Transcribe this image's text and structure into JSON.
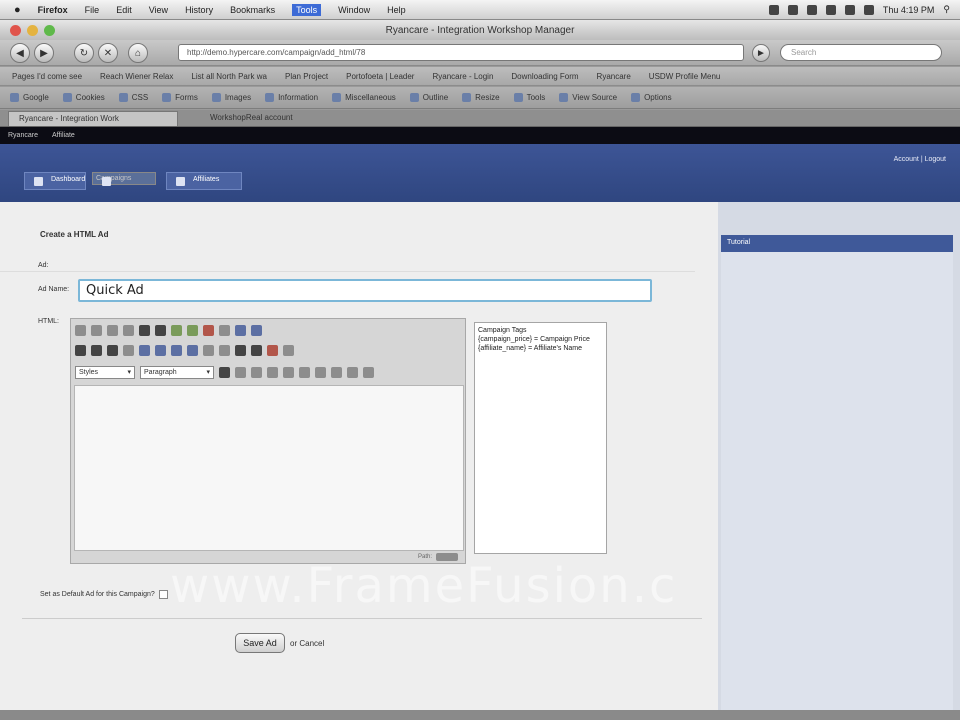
{
  "os_menu": {
    "apple": "",
    "items": [
      "Firefox",
      "File",
      "Edit",
      "View",
      "History",
      "Bookmarks",
      "Tools",
      "Window",
      "Help"
    ],
    "clock": "Thu 4:19 PM"
  },
  "window": {
    "title": "Ryancare - Integration Workshop Manager"
  },
  "browser": {
    "url": "http://demo.hypercare.com/campaign/add_html/78",
    "search_placeholder": "Search",
    "bookmarks": [
      "Pages I'd come see",
      "Reach Wiener Relax",
      "List all North Park wa",
      "Plan Project",
      "Portofoeta | Leader",
      "Ryancare - Login",
      "Downloading Form",
      "Ryancare",
      "USDW Profile Menu"
    ],
    "extensions": [
      "Google",
      "Cookies",
      "CSS",
      "Forms",
      "Images",
      "Information",
      "Miscellaneous",
      "Outline",
      "Resize",
      "Tools",
      "View Source",
      "Options"
    ],
    "tabs": [
      "Ryancare - Integration Work",
      "WorkshopReal account"
    ]
  },
  "app": {
    "top_strip": [
      "Ryancare",
      "Affiliate"
    ],
    "user_links": "Account | Logout",
    "nav_tabs": [
      {
        "label": "Dashboard"
      },
      {
        "label": "Campaigns"
      },
      {
        "label": "Affiliates"
      }
    ]
  },
  "form": {
    "title": "Create a HTML Ad",
    "ad_label": "Ad:",
    "name_label": "Ad Name:",
    "name_value": "Quick Ad",
    "html_label": "HTML:",
    "format_select": "Styles",
    "paragraph_select": "Paragraph",
    "editor_status": "Path:",
    "tags_title": "Campaign Tags",
    "tags": [
      "{campaign_price} = Campaign Price",
      "{affiliate_name} = Affiliate's Name"
    ],
    "checkbox_label": "Set as Default Ad for this Campaign?",
    "save_label": "Save Ad",
    "or_text": "or",
    "cancel_label": "Cancel"
  },
  "sidebar": {
    "header": "Tutorial"
  },
  "watermark": "www.FrameFusion.c"
}
